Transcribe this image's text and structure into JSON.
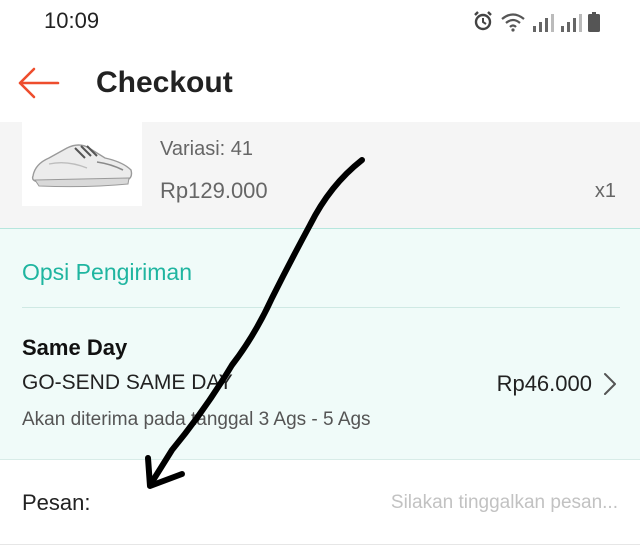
{
  "status_bar": {
    "time": "10:09",
    "icons": [
      "alarm-icon",
      "wifi-icon",
      "signal-icon",
      "signal-icon",
      "battery-icon"
    ]
  },
  "app_bar": {
    "back_icon": "arrow-left-icon",
    "title": "Checkout",
    "accent_color": "#ee4d2d"
  },
  "product": {
    "image": "sneaker-image",
    "variant": "Variasi: 41",
    "price": "Rp129.000",
    "quantity": "x1"
  },
  "shipping": {
    "header": "Opsi Pengiriman",
    "header_color": "#1fb5a0",
    "option": {
      "type": "Same Day",
      "service": "GO-SEND SAME DAY",
      "price": "Rp46.000",
      "eta": "Akan diterima pada tanggal 3 Ags - 5 Ags"
    }
  },
  "message": {
    "label": "Pesan:",
    "value": "",
    "placeholder": "Silakan tinggalkan pesan..."
  },
  "annotation": {
    "icon": "hand-drawn-arrow-icon",
    "color": "#000000"
  }
}
